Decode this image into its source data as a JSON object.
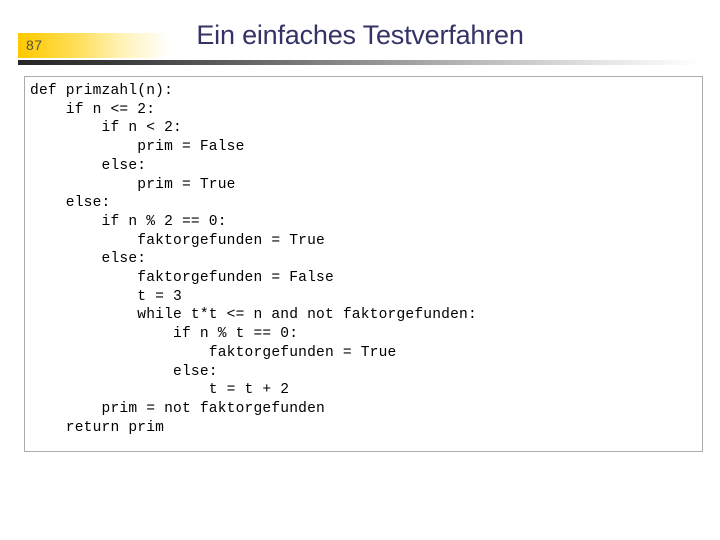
{
  "slide": {
    "page_number": "87",
    "title": "Ein einfaches Testverfahren",
    "title_color": "#333366",
    "badge_color": "#ffc800",
    "rule_color": "#262626"
  },
  "code": {
    "language": "python",
    "text": "def primzahl(n):\n    if n <= 2:\n        if n < 2:\n            prim = False\n        else:\n            prim = True\n    else:\n        if n % 2 == 0:\n            faktorgefunden = True\n        else:\n            faktorgefunden = False\n            t = 3\n            while t*t <= n and not faktorgefunden:\n                if n % t == 0:\n                    faktorgefunden = True\n                else:\n                    t = t + 2\n        prim = not faktorgefunden\n    return prim",
    "lines": [
      "def primzahl(n):",
      "    if n <= 2:",
      "        if n < 2:",
      "            prim = False",
      "        else:",
      "            prim = True",
      "    else:",
      "        if n % 2 == 0:",
      "            faktorgefunden = True",
      "        else:",
      "            faktorgefunden = False",
      "            t = 3",
      "            while t*t <= n and not faktorgefunden:",
      "                if n % t == 0:",
      "                    faktorgefunden = True",
      "                else:",
      "                    t = t + 2",
      "        prim = not faktorgefunden",
      "    return prim"
    ]
  }
}
